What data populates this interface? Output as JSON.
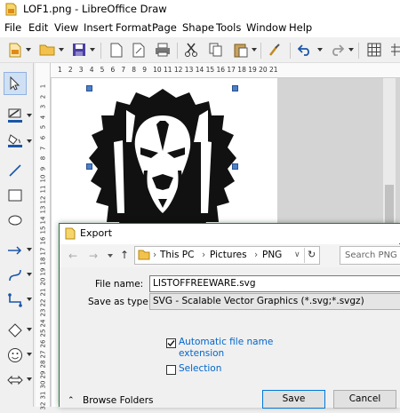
{
  "window": {
    "title": "LOF1.png - LibreOffice Draw"
  },
  "menu": [
    "File",
    "Edit",
    "View",
    "Insert",
    "Format",
    "Page",
    "Shape",
    "Tools",
    "Window",
    "Help"
  ],
  "hruler_ticks": [
    "1",
    "2",
    "3",
    "4",
    "5",
    "6",
    "7",
    "8",
    "9",
    "10",
    "11",
    "12",
    "13",
    "14",
    "15",
    "16",
    "17",
    "18",
    "19",
    "20",
    "21"
  ],
  "vruler_ticks": [
    "1",
    "2",
    "3",
    "4",
    "5",
    "6",
    "7",
    "8",
    "9",
    "10",
    "11",
    "12",
    "13",
    "14",
    "15",
    "16",
    "17",
    "18",
    "19",
    "20",
    "21",
    "22",
    "23",
    "24",
    "25",
    "26",
    "27",
    "28",
    "29",
    "30",
    "31",
    "32"
  ],
  "dialog": {
    "title": "Export",
    "breadcrumb": [
      "This PC",
      "Pictures",
      "PNG"
    ],
    "search_placeholder": "Search PNG",
    "file_name_label": "File name:",
    "file_name_value": "LISTOFFREEWARE.svg",
    "save_as_type_label": "Save as type:",
    "save_as_type_value": "SVG - Scalable Vector Graphics (*.svg;*.svgz)",
    "auto_ext_label": "Automatic file name extension",
    "auto_ext_checked": true,
    "selection_label": "Selection",
    "selection_checked": false,
    "browse_folders_label": "Browse Folders",
    "save_label": "Save",
    "cancel_label": "Cancel"
  },
  "colors": {
    "accent": "#1e7d3a",
    "link": "#0066cc",
    "select_blue": "#4a80c8"
  }
}
